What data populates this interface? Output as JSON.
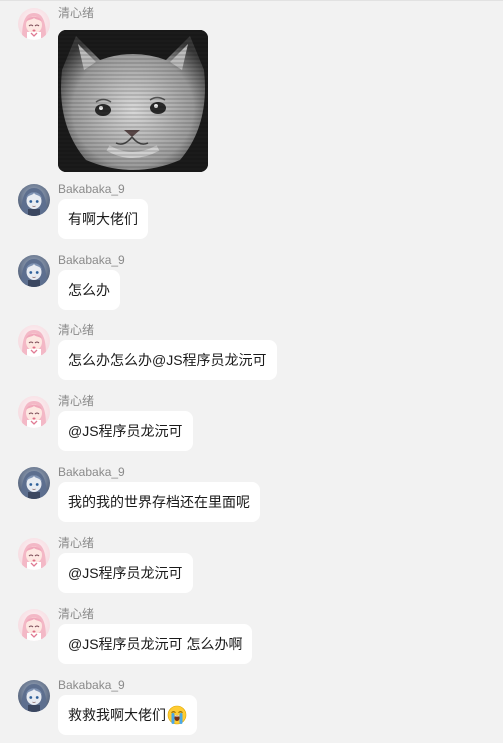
{
  "messages": [
    {
      "sender": "清心绪",
      "avatar": "pink-anime-avatar",
      "type": "image",
      "image": "crying-cat-meme"
    },
    {
      "sender": "Bakabaka_9",
      "avatar": "blue-anime-avatar",
      "type": "text",
      "text": "有啊大佬们"
    },
    {
      "sender": "Bakabaka_9",
      "avatar": "blue-anime-avatar",
      "type": "text",
      "text": "怎么办"
    },
    {
      "sender": "清心绪",
      "avatar": "pink-anime-avatar",
      "type": "text",
      "text": "怎么办怎么办@JS程序员龙沅可"
    },
    {
      "sender": "清心绪",
      "avatar": "pink-anime-avatar",
      "type": "text",
      "text": "@JS程序员龙沅可"
    },
    {
      "sender": "Bakabaka_9",
      "avatar": "blue-anime-avatar",
      "type": "text",
      "text": "我的我的世界存档还在里面呢"
    },
    {
      "sender": "清心绪",
      "avatar": "pink-anime-avatar",
      "type": "text",
      "text": "@JS程序员龙沅可"
    },
    {
      "sender": "清心绪",
      "avatar": "pink-anime-avatar",
      "type": "text",
      "text": "@JS程序员龙沅可 怎么办啊"
    },
    {
      "sender": "Bakabaka_9",
      "avatar": "blue-anime-avatar",
      "type": "text",
      "text": "救救我啊大佬们",
      "trailing_emoji": "loudly-crying-emoji"
    }
  ],
  "colors": {
    "background": "#f2f2f2",
    "bubble": "#ffffff",
    "sender_name": "#8a8a8a",
    "text": "#1a1a1a"
  }
}
